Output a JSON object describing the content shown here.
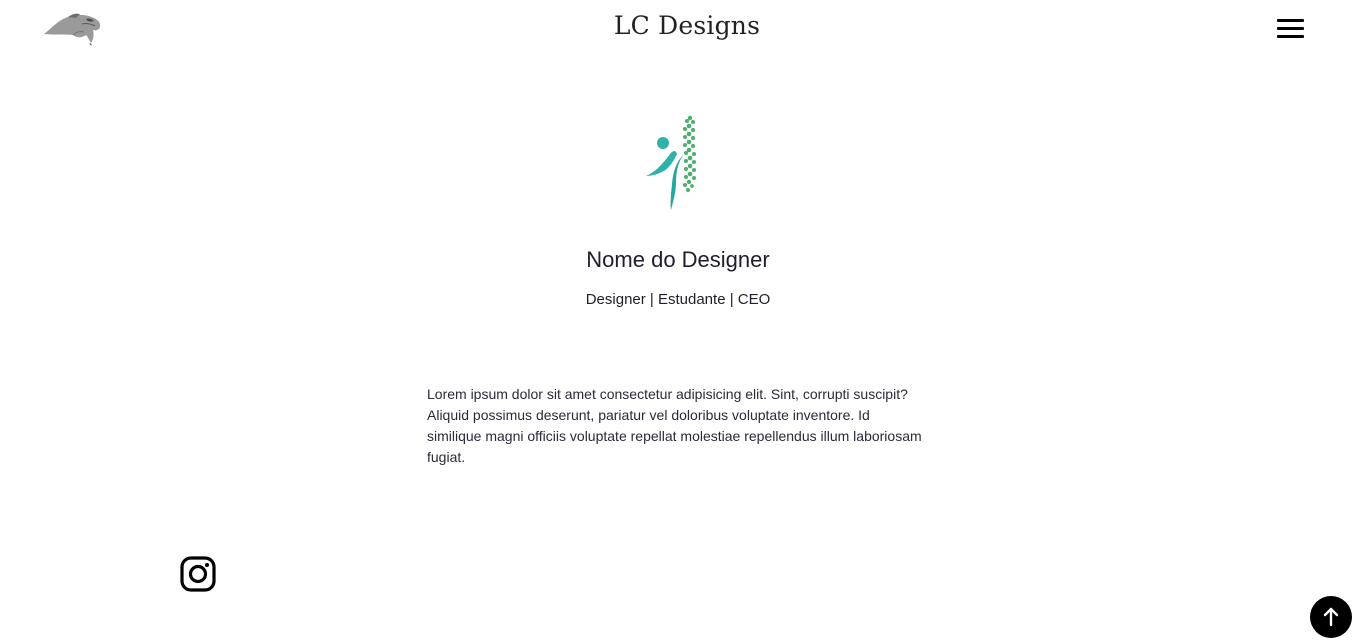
{
  "header": {
    "brand_title": "LC Designs",
    "logo_icon": "panther-head-icon",
    "menu_icon": "hamburger-menu-icon"
  },
  "profile": {
    "logo_icon": "spine-figure-logo",
    "name": "Nome do Designer",
    "roles": "Designer | Estudante | CEO",
    "bio": "Lorem ipsum dolor sit amet consectetur adipisicing elit. Sint, corrupti suscipit? Aliquid possimus deserunt, pariatur vel doloribus voluptate inventore. Id similique magni officiis voluptate repellat molestiae repellendus illum laboriosam fugiat."
  },
  "social": {
    "instagram_icon": "instagram-icon"
  },
  "footer": {
    "back_to_top_icon": "arrow-up-icon"
  },
  "colors": {
    "accent_teal": "#2fb3a8",
    "accent_green": "#4caf6e",
    "text_dark": "#1e1e2c",
    "button_black": "#000000"
  }
}
